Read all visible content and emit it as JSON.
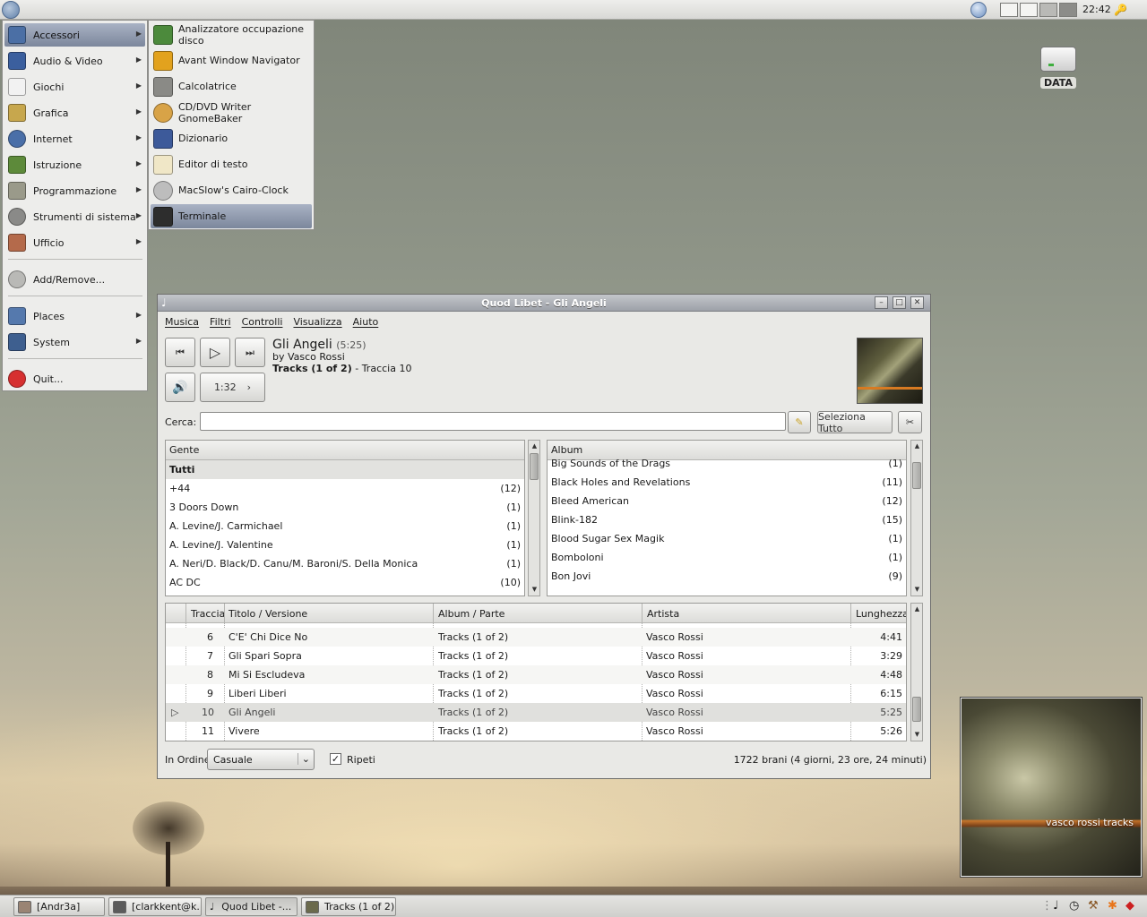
{
  "top_panel": {
    "clock": "22:42",
    "keys_glyph": "🔑",
    "workspaces": 4
  },
  "desktop_icon": {
    "label": "DATA"
  },
  "main_menu": {
    "items": [
      {
        "label": "Accessori",
        "icon": "accessories-icon",
        "color": "#4b6fa5",
        "submenu": true
      },
      {
        "label": "Audio & Video",
        "icon": "multimedia-icon",
        "color": "#3b5f9e",
        "submenu": true
      },
      {
        "label": "Giochi",
        "icon": "games-icon",
        "color": "#f2f2f2",
        "submenu": true
      },
      {
        "label": "Grafica",
        "icon": "graphics-icon",
        "color": "#c7a74d",
        "submenu": true
      },
      {
        "label": "Internet",
        "icon": "internet-icon",
        "color": "#4a6fa8",
        "submenu": true
      },
      {
        "label": "Istruzione",
        "icon": "education-icon",
        "color": "#5d8a3a",
        "submenu": true
      },
      {
        "label": "Programmazione",
        "icon": "development-icon",
        "color": "#9a9a8a",
        "submenu": true
      },
      {
        "label": "Strumenti di sistema",
        "icon": "system-tools-icon",
        "color": "#8a8a88",
        "submenu": true
      },
      {
        "label": "Ufficio",
        "icon": "office-icon",
        "color": "#b46a4b",
        "submenu": true
      }
    ],
    "add_remove": "Add/Remove...",
    "places": "Places",
    "system": "System",
    "quit": "Quit..."
  },
  "sub_menu": {
    "items": [
      {
        "label": "Analizzatore occupazione disco",
        "icon": "disk-usage-icon",
        "color": "#4c8a3c"
      },
      {
        "label": "Avant Window Navigator",
        "icon": "awn-icon",
        "color": "#e2a21e"
      },
      {
        "label": "Calcolatrice",
        "icon": "calculator-icon",
        "color": "#8a8a86"
      },
      {
        "label": "CD/DVD Writer GnomeBaker",
        "icon": "cd-writer-icon",
        "color": "#d8a347"
      },
      {
        "label": "Dizionario",
        "icon": "dictionary-icon",
        "color": "#3d5a9a"
      },
      {
        "label": "Editor di testo",
        "icon": "text-editor-icon",
        "color": "#f0e7c7"
      },
      {
        "label": "MacSlow's Cairo-Clock",
        "icon": "clock-icon",
        "color": "#bdbdbd"
      },
      {
        "label": "Terminale",
        "icon": "terminal-icon",
        "color": "#2d2d2d"
      }
    ]
  },
  "window": {
    "title": "Quod Libet - Gli Angeli",
    "menu": [
      "Musica",
      "Filtri",
      "Controlli",
      "Visualizza",
      "Aiuto"
    ],
    "now_playing": {
      "title": "Gli Angeli",
      "length": "(5:25)",
      "by": "by Vasco Rossi",
      "album": "Tracks (1 of 2)",
      "track": " - Traccia 10"
    },
    "position": "1:32",
    "search_label": "Cerca:",
    "search_value": "",
    "select_all": "Seleziona Tutto",
    "people": {
      "header": "Gente",
      "rows": [
        {
          "name": "Tutti",
          "count": ""
        },
        {
          "name": "+44",
          "count": "(12)"
        },
        {
          "name": "3 Doors Down",
          "count": "(1)"
        },
        {
          "name": "A. Levine/J. Carmichael",
          "count": "(1)"
        },
        {
          "name": "A. Levine/J. Valentine",
          "count": "(1)"
        },
        {
          "name": "A. Neri/D. Black/D. Canu/M. Baroni/S. Della Monica",
          "count": "(1)"
        },
        {
          "name": "AC DC",
          "count": "(10)"
        }
      ]
    },
    "albums": {
      "header": "Album",
      "rows": [
        {
          "name": "Big Sounds of the Drags",
          "count": "(1)"
        },
        {
          "name": "Black Holes and Revelations",
          "count": "(11)"
        },
        {
          "name": "Bleed American",
          "count": "(12)"
        },
        {
          "name": "Blink-182",
          "count": "(15)"
        },
        {
          "name": "Blood Sugar Sex Magik",
          "count": "(1)"
        },
        {
          "name": "Bomboloni",
          "count": "(1)"
        },
        {
          "name": "Bon Jovi",
          "count": "(9)"
        }
      ]
    },
    "tracks": {
      "headers": [
        "Traccia",
        "Titolo / Versione",
        "Album / Parte",
        "Artista",
        "Lunghezza"
      ],
      "rows": [
        {
          "n": "6",
          "title": "C'E' Chi Dice No",
          "album": "Tracks (1 of 2)",
          "artist": "Vasco Rossi",
          "len": "4:41"
        },
        {
          "n": "7",
          "title": "Gli Spari Sopra",
          "album": "Tracks (1 of 2)",
          "artist": "Vasco Rossi",
          "len": "3:29"
        },
        {
          "n": "8",
          "title": "Mi Si Escludeva",
          "album": "Tracks (1 of 2)",
          "artist": "Vasco Rossi",
          "len": "4:48"
        },
        {
          "n": "9",
          "title": "Liberi Liberi",
          "album": "Tracks (1 of 2)",
          "artist": "Vasco Rossi",
          "len": "6:15"
        },
        {
          "n": "10",
          "title": "Gli Angeli",
          "album": "Tracks (1 of 2)",
          "artist": "Vasco Rossi",
          "len": "5:25"
        },
        {
          "n": "11",
          "title": "Vivere",
          "album": "Tracks (1 of 2)",
          "artist": "Vasco Rossi",
          "len": "5:26"
        }
      ]
    },
    "order_label": "In Ordine",
    "order_value": "Casuale",
    "repeat_label": "Ripeti",
    "status": "1722 brani (4 giorni, 23 ore, 24 minuti)"
  },
  "cover_caption": "vasco rossi tracks",
  "taskbar": {
    "tasks": [
      "[Andr3a]",
      "[clarkkent@k...",
      "Quod Libet -...",
      "Tracks (1 of 2)"
    ]
  }
}
